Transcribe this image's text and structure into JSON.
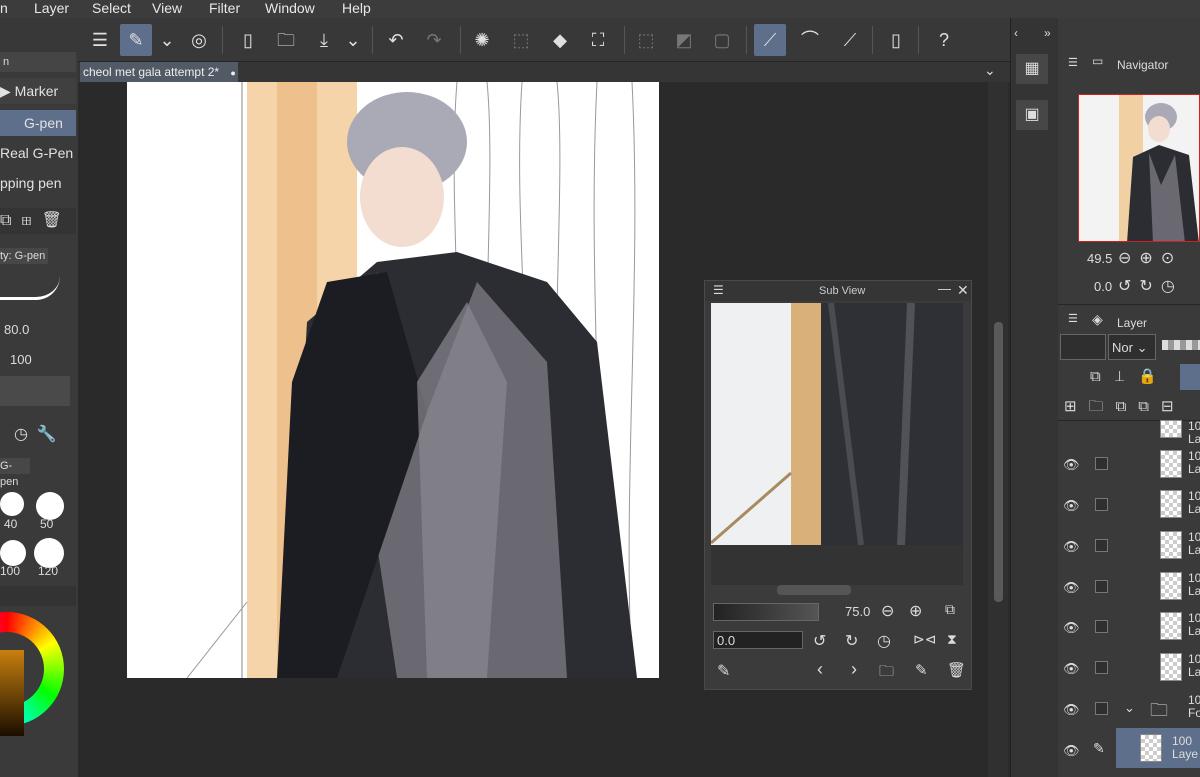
{
  "menu": [
    "n",
    "Layer",
    "Select",
    "View",
    "Filter",
    "Window",
    "Help"
  ],
  "document": {
    "tab_title": "cheol met gala attempt 2*"
  },
  "sub_tool": {
    "group": "Marker",
    "items": [
      "G-pen",
      "Real G-Pen",
      "pping pen"
    ]
  },
  "tool_property": {
    "title": "ty: G-pen",
    "size": "80.0",
    "opacity": "100"
  },
  "brush_size": {
    "title": "G-pen",
    "sizes": [
      "40",
      "50",
      "100",
      "120"
    ]
  },
  "navigator": {
    "title": "Navigator",
    "zoom": "49.5",
    "rotation": "0.0"
  },
  "subview": {
    "title": "Sub View",
    "zoom": "75.0",
    "rotation": "0.0"
  },
  "layer_panel": {
    "title": "Layer",
    "blend": "Nor",
    "rows": [
      {
        "opacity": "10",
        "name": "La"
      },
      {
        "opacity": "10",
        "name": "La"
      },
      {
        "opacity": "10",
        "name": "La"
      },
      {
        "opacity": "10",
        "name": "La"
      },
      {
        "opacity": "10",
        "name": "La"
      },
      {
        "opacity": "10",
        "name": "La"
      },
      {
        "opacity": "10",
        "name": "La"
      }
    ],
    "folder": {
      "opacity": "100",
      "name": "Fol"
    },
    "selected": {
      "opacity": "100 ",
      "name": "Laye"
    }
  },
  "colors": {
    "accent": "#5d6f8a",
    "canvas_bg": "#ffffff"
  }
}
